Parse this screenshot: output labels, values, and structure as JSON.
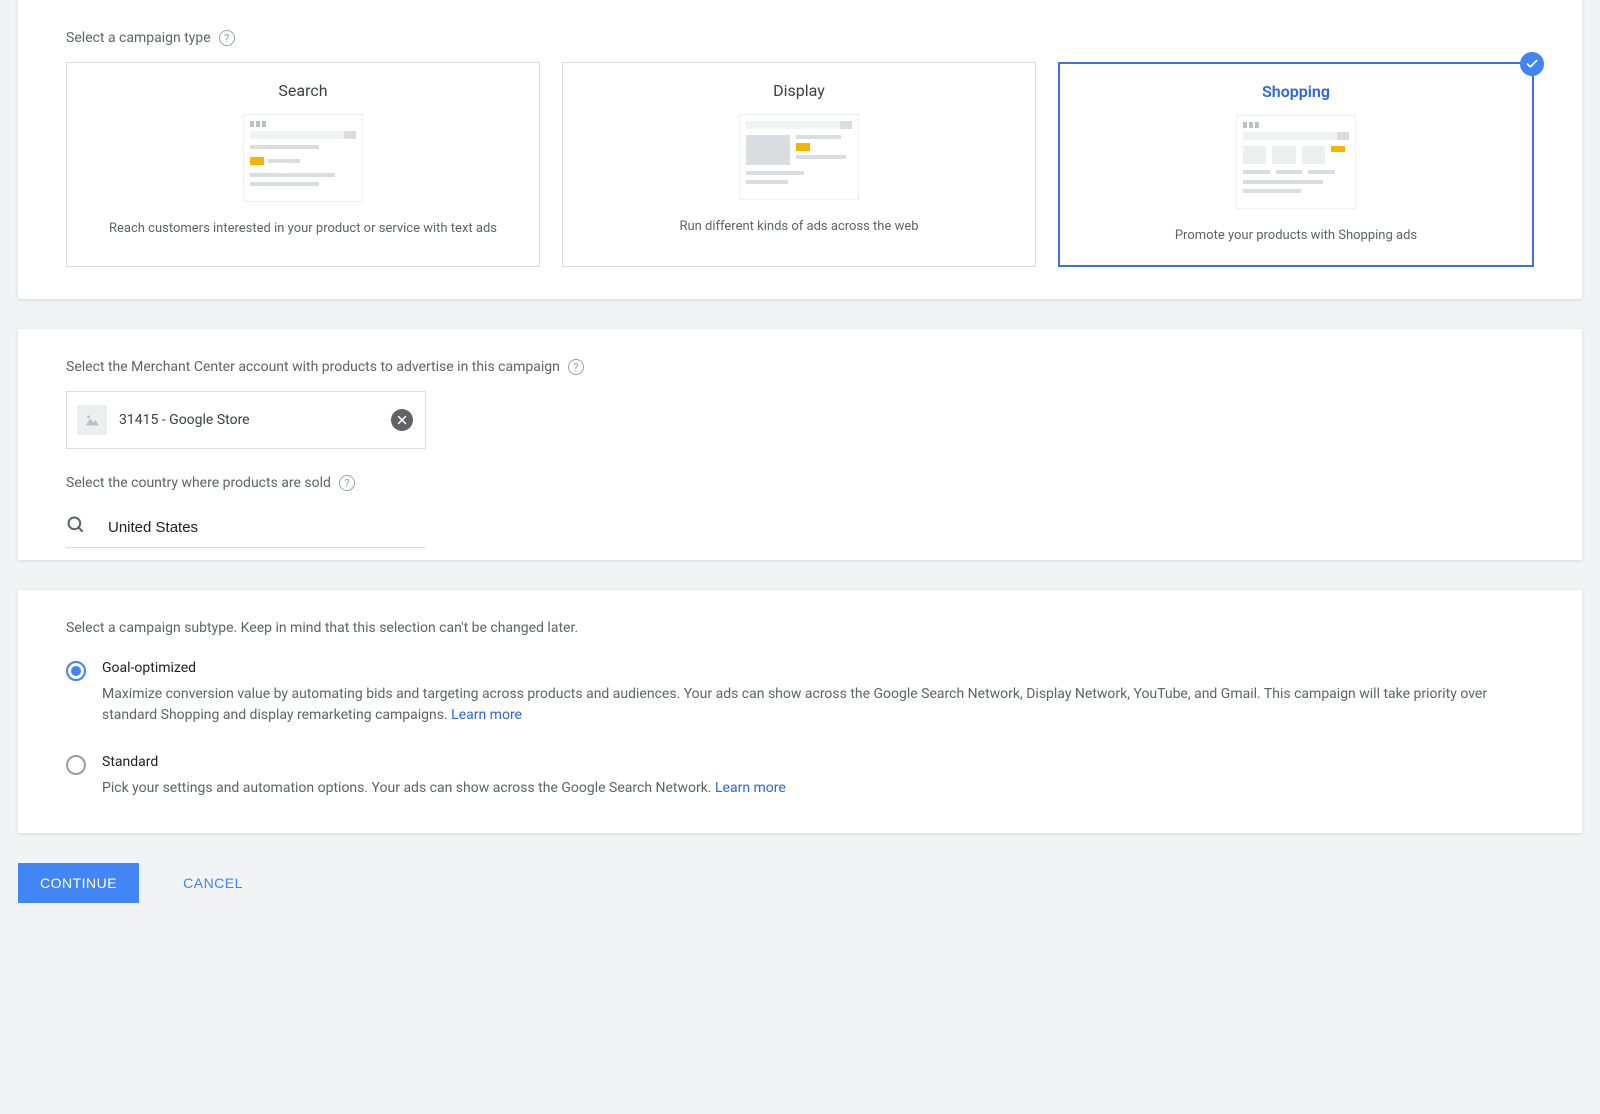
{
  "section1": {
    "label": "Select a campaign type",
    "cards": [
      {
        "title": "Search",
        "desc": "Reach customers interested in your product or service with text ads"
      },
      {
        "title": "Display",
        "desc": "Run different kinds of ads across the web"
      },
      {
        "title": "Shopping",
        "desc": "Promote your products with Shopping ads"
      }
    ]
  },
  "section2": {
    "merchant_label": "Select the Merchant Center account with products to advertise in this campaign",
    "merchant_value": "31415 - Google Store",
    "country_label": "Select the country where products are sold",
    "country_value": "United States"
  },
  "section3": {
    "label": "Select a campaign subtype. Keep in mind that this selection can't be changed later.",
    "options": [
      {
        "title": "Goal-optimized",
        "desc": "Maximize conversion value by automating bids and targeting across products and audiences. Your ads can show across the Google Search Network, Display Network, YouTube, and Gmail. This campaign will take priority over standard Shopping and display remarketing campaigns. ",
        "learn": "Learn more"
      },
      {
        "title": "Standard",
        "desc": "Pick your settings and automation options. Your ads can show across the Google Search Network. ",
        "learn": "Learn more"
      }
    ]
  },
  "footer": {
    "continue": "Continue",
    "cancel": "Cancel"
  }
}
